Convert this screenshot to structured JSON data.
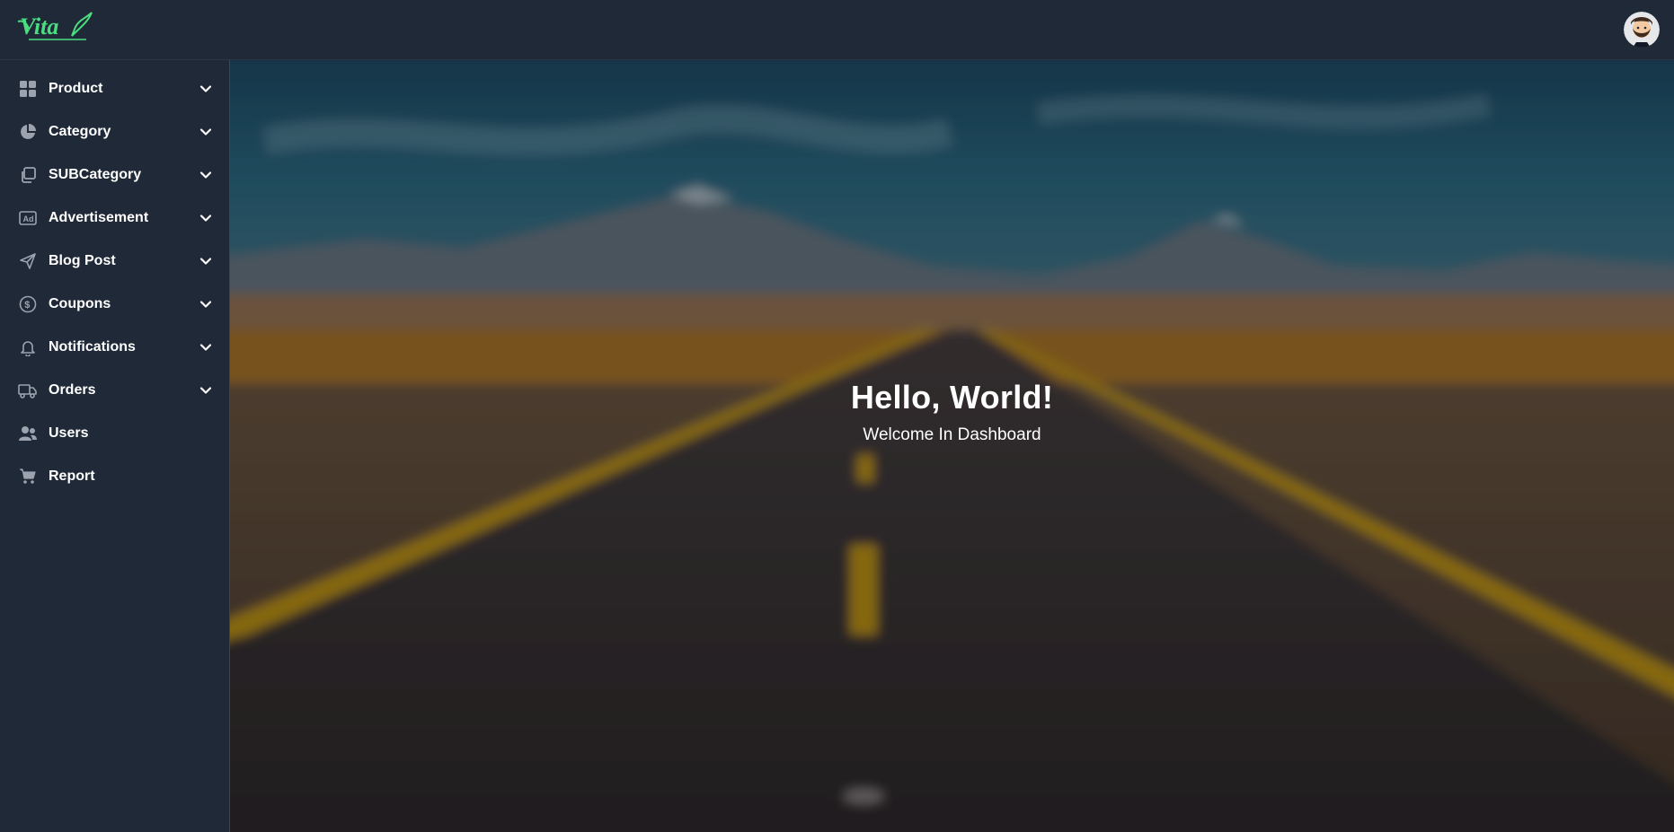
{
  "brand": {
    "logo_text": "Vita",
    "colors": {
      "accent": "#4ade80",
      "sidebar_bg": "#1f2937",
      "text": "#ffffff"
    }
  },
  "header": {
    "avatar_icon": "user-avatar-icon"
  },
  "sidebar": {
    "items": [
      {
        "label": "Product",
        "icon": "grid-icon",
        "expandable": true
      },
      {
        "label": "Category",
        "icon": "pie-chart-icon",
        "expandable": true
      },
      {
        "label": "SUBCategory",
        "icon": "copy-icon",
        "expandable": true
      },
      {
        "label": "Advertisement",
        "icon": "ad-icon",
        "expandable": true
      },
      {
        "label": "Blog Post",
        "icon": "send-icon",
        "expandable": true
      },
      {
        "label": "Coupons",
        "icon": "dollar-circle-icon",
        "expandable": true
      },
      {
        "label": "Notifications",
        "icon": "bell-icon",
        "expandable": true
      },
      {
        "label": "Orders",
        "icon": "truck-icon",
        "expandable": true
      },
      {
        "label": "Users",
        "icon": "users-icon",
        "expandable": false
      },
      {
        "label": "Report",
        "icon": "cart-icon",
        "expandable": false
      }
    ]
  },
  "main": {
    "title": "Hello, World!",
    "subtitle": "Welcome In Dashboard",
    "background": "road-landscape-image"
  }
}
